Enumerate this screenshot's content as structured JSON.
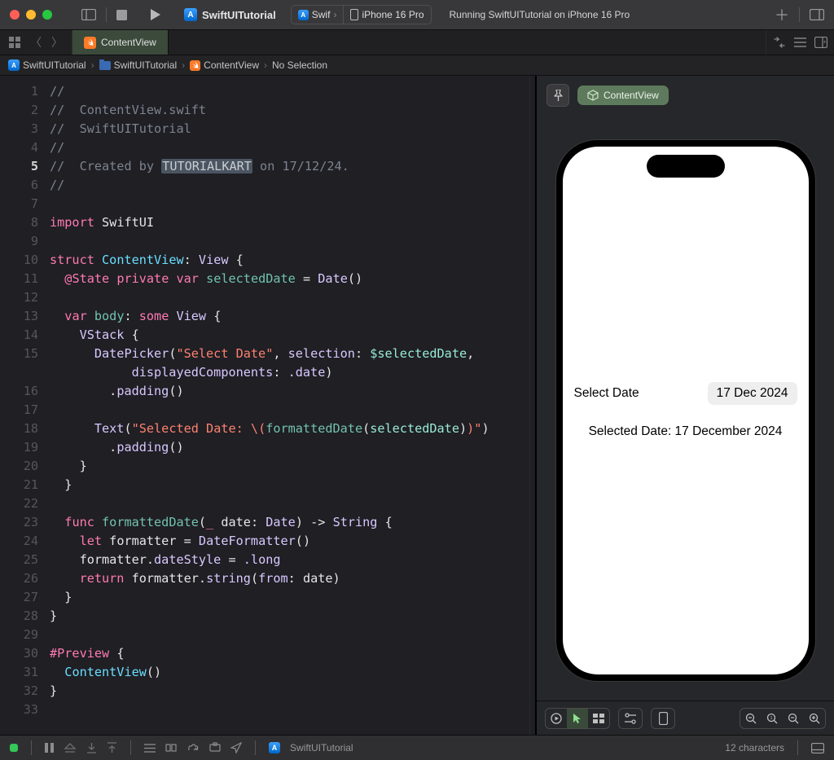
{
  "titlebar": {
    "project": "SwiftUITutorial",
    "scheme_left": "Swif",
    "scheme_right": "iPhone 16 Pro",
    "status": "Running SwiftUITutorial on iPhone 16 Pro"
  },
  "tab": {
    "label": "ContentView"
  },
  "breadcrumb": {
    "a": "SwiftUITutorial",
    "b": "SwiftUITutorial",
    "c": "ContentView",
    "d": "No Selection"
  },
  "gutter": {
    "lines": [
      "1",
      "2",
      "3",
      "4",
      "5",
      "6",
      "7",
      "8",
      "9",
      "10",
      "11",
      "12",
      "13",
      "14",
      "15",
      "",
      "16",
      "17",
      "18",
      "19",
      "20",
      "21",
      "22",
      "23",
      "24",
      "25",
      "26",
      "27",
      "28",
      "29",
      "30",
      "31",
      "32",
      "33"
    ],
    "current": 5
  },
  "code": {
    "l1": "//",
    "l2a": "//",
    "l2b": "  ContentView.swift",
    "l3a": "//",
    "l3b": "  SwiftUITutorial",
    "l4": "//",
    "l5a": "//",
    "l5b": "  Created by ",
    "l5name": "TUTORIALKART",
    "l5c": " on 17/12/24.",
    "l6": "//",
    "kw_import": "import",
    "swiftui": "SwiftUI",
    "kw_struct": "struct",
    "contentview": "ContentView",
    "view": "View",
    "state": "@State",
    "private": "private",
    "var": "var",
    "seldate": "selectedDate",
    "date": "Date",
    "body": "body",
    "some": "some",
    "vstack": "VStack",
    "datepicker": "DatePicker",
    "dp_label": "\"Select Date\"",
    "selection": "selection",
    "dollarsel": "$selectedDate",
    "displayed": "displayedComponents",
    "dotdate": ".date",
    "padding": "padding",
    "text": "Text",
    "selstr1": "\"Selected Date: ",
    "bs": "\\(",
    "fdcall": "formattedDate",
    "paren_sel": "selectedDate",
    "close": ")",
    "endq": "\"",
    "func": "func",
    "formattedDate": "formattedDate",
    "underscore": "_",
    "dateparam": "date",
    "dateType": "Date",
    "arrow": "->",
    "string": "String",
    "let": "let",
    "formatter": "formatter",
    "dateformatter": "DateFormatter",
    "datestyle": "dateStyle",
    "long": ".long",
    "return": "return",
    "stringm": "string",
    "from": "from",
    "preview": "#Preview"
  },
  "preview": {
    "chip": "ContentView",
    "dp_label": "Select Date",
    "dp_value": "17 Dec 2024",
    "selected_text": "Selected Date: 17 December 2024"
  },
  "bottom": {
    "project": "SwiftUITutorial",
    "chars": "12 characters"
  }
}
